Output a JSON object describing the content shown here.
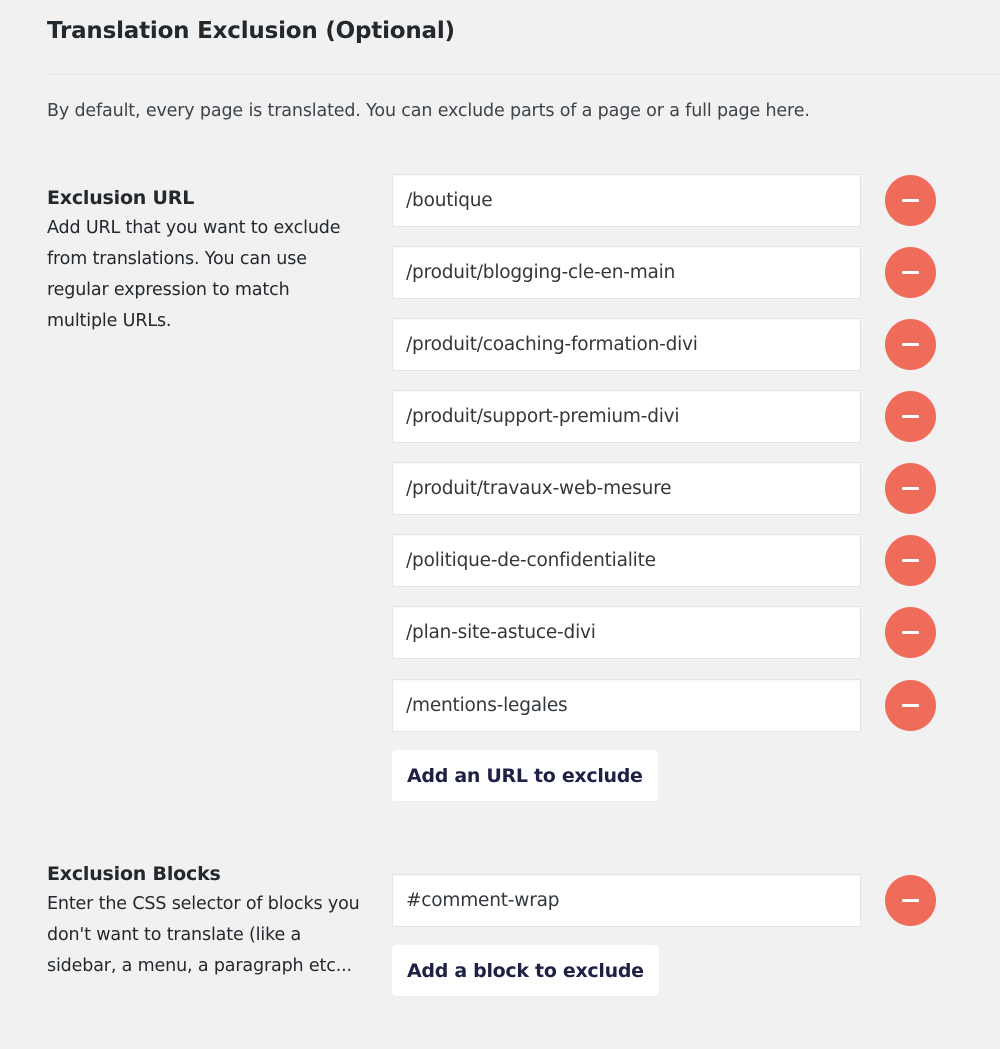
{
  "header": {
    "title": "Translation Exclusion (Optional)",
    "intro": "By default, every page is translated. You can exclude parts of a page or a full page here."
  },
  "exclusion_url": {
    "label": "Exclusion URL",
    "description": "Add URL that you want to exclude from translations. You can use regular expression to match multiple URLs.",
    "values": [
      "/boutique",
      "/produit/blogging-cle-en-main",
      "/produit/coaching-formation-divi",
      "/produit/support-premium-divi",
      "/produit/travaux-web-mesure",
      "/politique-de-confidentialite",
      "/plan-site-astuce-divi",
      "/mentions-legales"
    ],
    "remove_icon": "minus-circle-icon",
    "add_label": "Add an URL to exclude"
  },
  "exclusion_blocks": {
    "label": "Exclusion Blocks",
    "description": "Enter the CSS selector of blocks you don't want to translate (like a sidebar, a menu, a paragraph etc...",
    "values": [
      "#comment-wrap"
    ],
    "remove_icon": "minus-circle-icon",
    "add_label": "Add a block to exclude"
  },
  "colors": {
    "background": "#f1f1f1",
    "remove_button": "#ef6b5a",
    "add_button_text": "#1e2145",
    "text": "#23282d"
  }
}
